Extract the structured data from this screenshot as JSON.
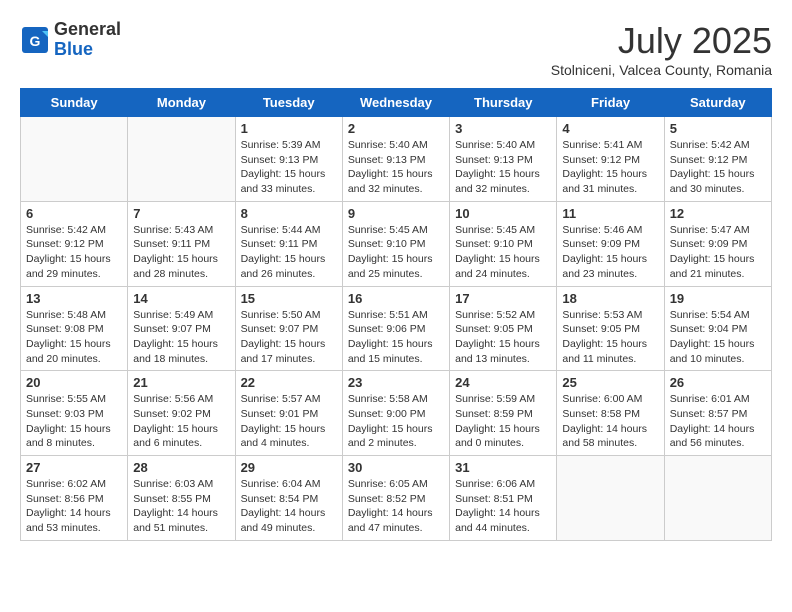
{
  "logo": {
    "general": "General",
    "blue": "Blue"
  },
  "header": {
    "month": "July 2025",
    "location": "Stolniceni, Valcea County, Romania"
  },
  "days_of_week": [
    "Sunday",
    "Monday",
    "Tuesday",
    "Wednesday",
    "Thursday",
    "Friday",
    "Saturday"
  ],
  "weeks": [
    [
      {
        "day": "",
        "info": ""
      },
      {
        "day": "",
        "info": ""
      },
      {
        "day": "1",
        "info": "Sunrise: 5:39 AM\nSunset: 9:13 PM\nDaylight: 15 hours\nand 33 minutes."
      },
      {
        "day": "2",
        "info": "Sunrise: 5:40 AM\nSunset: 9:13 PM\nDaylight: 15 hours\nand 32 minutes."
      },
      {
        "day": "3",
        "info": "Sunrise: 5:40 AM\nSunset: 9:13 PM\nDaylight: 15 hours\nand 32 minutes."
      },
      {
        "day": "4",
        "info": "Sunrise: 5:41 AM\nSunset: 9:12 PM\nDaylight: 15 hours\nand 31 minutes."
      },
      {
        "day": "5",
        "info": "Sunrise: 5:42 AM\nSunset: 9:12 PM\nDaylight: 15 hours\nand 30 minutes."
      }
    ],
    [
      {
        "day": "6",
        "info": "Sunrise: 5:42 AM\nSunset: 9:12 PM\nDaylight: 15 hours\nand 29 minutes."
      },
      {
        "day": "7",
        "info": "Sunrise: 5:43 AM\nSunset: 9:11 PM\nDaylight: 15 hours\nand 28 minutes."
      },
      {
        "day": "8",
        "info": "Sunrise: 5:44 AM\nSunset: 9:11 PM\nDaylight: 15 hours\nand 26 minutes."
      },
      {
        "day": "9",
        "info": "Sunrise: 5:45 AM\nSunset: 9:10 PM\nDaylight: 15 hours\nand 25 minutes."
      },
      {
        "day": "10",
        "info": "Sunrise: 5:45 AM\nSunset: 9:10 PM\nDaylight: 15 hours\nand 24 minutes."
      },
      {
        "day": "11",
        "info": "Sunrise: 5:46 AM\nSunset: 9:09 PM\nDaylight: 15 hours\nand 23 minutes."
      },
      {
        "day": "12",
        "info": "Sunrise: 5:47 AM\nSunset: 9:09 PM\nDaylight: 15 hours\nand 21 minutes."
      }
    ],
    [
      {
        "day": "13",
        "info": "Sunrise: 5:48 AM\nSunset: 9:08 PM\nDaylight: 15 hours\nand 20 minutes."
      },
      {
        "day": "14",
        "info": "Sunrise: 5:49 AM\nSunset: 9:07 PM\nDaylight: 15 hours\nand 18 minutes."
      },
      {
        "day": "15",
        "info": "Sunrise: 5:50 AM\nSunset: 9:07 PM\nDaylight: 15 hours\nand 17 minutes."
      },
      {
        "day": "16",
        "info": "Sunrise: 5:51 AM\nSunset: 9:06 PM\nDaylight: 15 hours\nand 15 minutes."
      },
      {
        "day": "17",
        "info": "Sunrise: 5:52 AM\nSunset: 9:05 PM\nDaylight: 15 hours\nand 13 minutes."
      },
      {
        "day": "18",
        "info": "Sunrise: 5:53 AM\nSunset: 9:05 PM\nDaylight: 15 hours\nand 11 minutes."
      },
      {
        "day": "19",
        "info": "Sunrise: 5:54 AM\nSunset: 9:04 PM\nDaylight: 15 hours\nand 10 minutes."
      }
    ],
    [
      {
        "day": "20",
        "info": "Sunrise: 5:55 AM\nSunset: 9:03 PM\nDaylight: 15 hours\nand 8 minutes."
      },
      {
        "day": "21",
        "info": "Sunrise: 5:56 AM\nSunset: 9:02 PM\nDaylight: 15 hours\nand 6 minutes."
      },
      {
        "day": "22",
        "info": "Sunrise: 5:57 AM\nSunset: 9:01 PM\nDaylight: 15 hours\nand 4 minutes."
      },
      {
        "day": "23",
        "info": "Sunrise: 5:58 AM\nSunset: 9:00 PM\nDaylight: 15 hours\nand 2 minutes."
      },
      {
        "day": "24",
        "info": "Sunrise: 5:59 AM\nSunset: 8:59 PM\nDaylight: 15 hours\nand 0 minutes."
      },
      {
        "day": "25",
        "info": "Sunrise: 6:00 AM\nSunset: 8:58 PM\nDaylight: 14 hours\nand 58 minutes."
      },
      {
        "day": "26",
        "info": "Sunrise: 6:01 AM\nSunset: 8:57 PM\nDaylight: 14 hours\nand 56 minutes."
      }
    ],
    [
      {
        "day": "27",
        "info": "Sunrise: 6:02 AM\nSunset: 8:56 PM\nDaylight: 14 hours\nand 53 minutes."
      },
      {
        "day": "28",
        "info": "Sunrise: 6:03 AM\nSunset: 8:55 PM\nDaylight: 14 hours\nand 51 minutes."
      },
      {
        "day": "29",
        "info": "Sunrise: 6:04 AM\nSunset: 8:54 PM\nDaylight: 14 hours\nand 49 minutes."
      },
      {
        "day": "30",
        "info": "Sunrise: 6:05 AM\nSunset: 8:52 PM\nDaylight: 14 hours\nand 47 minutes."
      },
      {
        "day": "31",
        "info": "Sunrise: 6:06 AM\nSunset: 8:51 PM\nDaylight: 14 hours\nand 44 minutes."
      },
      {
        "day": "",
        "info": ""
      },
      {
        "day": "",
        "info": ""
      }
    ]
  ]
}
